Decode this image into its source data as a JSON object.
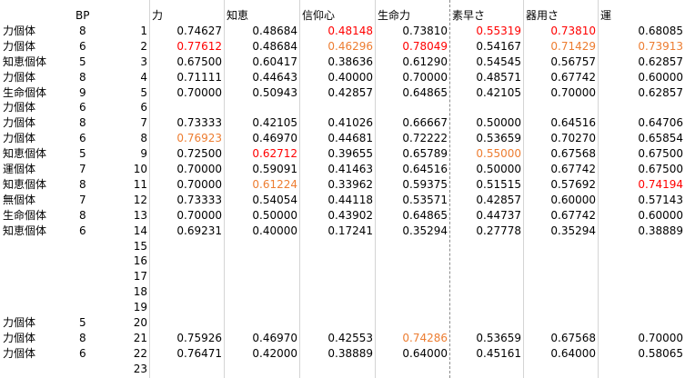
{
  "colors": {
    "red": "#ff0000",
    "orange": "#ed7d31",
    "black": "#000000"
  },
  "header": {
    "bp": "BP",
    "cols": [
      "力",
      "知恵",
      "信仰心",
      "生命力",
      "素早さ",
      "器用さ",
      "運"
    ]
  },
  "rows": [
    {
      "type": "力個体",
      "bp": "8",
      "n": "1",
      "v": [
        "0.74627",
        "0.48684",
        "0.48148",
        "0.73810",
        "0.55319",
        "0.73810",
        "0.68085"
      ],
      "c": [
        "",
        "",
        "red",
        "",
        "red",
        "red",
        ""
      ]
    },
    {
      "type": "力個体",
      "bp": "6",
      "n": "2",
      "v": [
        "0.77612",
        "0.48684",
        "0.46296",
        "0.78049",
        "0.54167",
        "0.71429",
        "0.73913"
      ],
      "c": [
        "red",
        "",
        "orange",
        "red",
        "",
        "orange",
        "orange"
      ]
    },
    {
      "type": "知恵個体",
      "bp": "5",
      "n": "3",
      "v": [
        "0.67500",
        "0.60417",
        "0.38636",
        "0.61290",
        "0.54545",
        "0.56757",
        "0.62857"
      ],
      "c": [
        "",
        "",
        "",
        "",
        "",
        "",
        ""
      ]
    },
    {
      "type": "力個体",
      "bp": "8",
      "n": "4",
      "v": [
        "0.71111",
        "0.44643",
        "0.40000",
        "0.70000",
        "0.48571",
        "0.67742",
        "0.60000"
      ],
      "c": [
        "",
        "",
        "",
        "",
        "",
        "",
        ""
      ]
    },
    {
      "type": "生命個体",
      "bp": "9",
      "n": "5",
      "v": [
        "0.70000",
        "0.50943",
        "0.42857",
        "0.64865",
        "0.42105",
        "0.70000",
        "0.62857"
      ],
      "c": [
        "",
        "",
        "",
        "",
        "",
        "",
        ""
      ]
    },
    {
      "type": "力個体",
      "bp": "6",
      "n": "6",
      "v": [
        "",
        "",
        "",
        "",
        "",
        "",
        ""
      ],
      "c": [
        "",
        "",
        "",
        "",
        "",
        "",
        ""
      ]
    },
    {
      "type": "力個体",
      "bp": "8",
      "n": "7",
      "v": [
        "0.73333",
        "0.42105",
        "0.41026",
        "0.66667",
        "0.50000",
        "0.64516",
        "0.64706"
      ],
      "c": [
        "",
        "",
        "",
        "",
        "",
        "",
        ""
      ]
    },
    {
      "type": "力個体",
      "bp": "6",
      "n": "8",
      "v": [
        "0.76923",
        "0.46970",
        "0.44681",
        "0.72222",
        "0.53659",
        "0.70270",
        "0.65854"
      ],
      "c": [
        "orange",
        "",
        "",
        "",
        "",
        "",
        ""
      ]
    },
    {
      "type": "知恵個体",
      "bp": "5",
      "n": "9",
      "v": [
        "0.72500",
        "0.62712",
        "0.39655",
        "0.65789",
        "0.55000",
        "0.67568",
        "0.67500"
      ],
      "c": [
        "",
        "red",
        "",
        "",
        "orange",
        "",
        ""
      ]
    },
    {
      "type": "運個体",
      "bp": "7",
      "n": "10",
      "v": [
        "0.70000",
        "0.59091",
        "0.41463",
        "0.64516",
        "0.50000",
        "0.67742",
        "0.67500"
      ],
      "c": [
        "",
        "",
        "",
        "",
        "",
        "",
        ""
      ]
    },
    {
      "type": "知恵個体",
      "bp": "8",
      "n": "11",
      "v": [
        "0.70000",
        "0.61224",
        "0.33962",
        "0.59375",
        "0.51515",
        "0.57692",
        "0.74194"
      ],
      "c": [
        "",
        "orange",
        "",
        "",
        "",
        "",
        "red"
      ]
    },
    {
      "type": "無個体",
      "bp": "7",
      "n": "12",
      "v": [
        "0.73333",
        "0.54054",
        "0.44118",
        "0.53571",
        "0.42857",
        "0.60000",
        "0.57143"
      ],
      "c": [
        "",
        "",
        "",
        "",
        "",
        "",
        ""
      ]
    },
    {
      "type": "生命個体",
      "bp": "8",
      "n": "13",
      "v": [
        "0.70000",
        "0.50000",
        "0.43902",
        "0.64865",
        "0.44737",
        "0.67742",
        "0.60000"
      ],
      "c": [
        "",
        "",
        "",
        "",
        "",
        "",
        ""
      ]
    },
    {
      "type": "知恵個体",
      "bp": "6",
      "n": "14",
      "v": [
        "0.69231",
        "0.40000",
        "0.17241",
        "0.35294",
        "0.27778",
        "0.35294",
        "0.38889"
      ],
      "c": [
        "",
        "",
        "",
        "",
        "",
        "",
        ""
      ]
    },
    {
      "type": "",
      "bp": "",
      "n": "15",
      "v": [
        "",
        "",
        "",
        "",
        "",
        "",
        ""
      ],
      "c": [
        "",
        "",
        "",
        "",
        "",
        "",
        ""
      ]
    },
    {
      "type": "",
      "bp": "",
      "n": "16",
      "v": [
        "",
        "",
        "",
        "",
        "",
        "",
        ""
      ],
      "c": [
        "",
        "",
        "",
        "",
        "",
        "",
        ""
      ]
    },
    {
      "type": "",
      "bp": "",
      "n": "17",
      "v": [
        "",
        "",
        "",
        "",
        "",
        "",
        ""
      ],
      "c": [
        "",
        "",
        "",
        "",
        "",
        "",
        ""
      ]
    },
    {
      "type": "",
      "bp": "",
      "n": "18",
      "v": [
        "",
        "",
        "",
        "",
        "",
        "",
        ""
      ],
      "c": [
        "",
        "",
        "",
        "",
        "",
        "",
        ""
      ]
    },
    {
      "type": "",
      "bp": "",
      "n": "19",
      "v": [
        "",
        "",
        "",
        "",
        "",
        "",
        ""
      ],
      "c": [
        "",
        "",
        "",
        "",
        "",
        "",
        ""
      ]
    },
    {
      "type": "力個体",
      "bp": "5",
      "n": "20",
      "v": [
        "",
        "",
        "",
        "",
        "",
        "",
        ""
      ],
      "c": [
        "",
        "",
        "",
        "",
        "",
        "",
        ""
      ]
    },
    {
      "type": "力個体",
      "bp": "8",
      "n": "21",
      "v": [
        "0.75926",
        "0.46970",
        "0.42553",
        "0.74286",
        "0.53659",
        "0.67568",
        "0.70000"
      ],
      "c": [
        "",
        "",
        "",
        "orange",
        "",
        "",
        ""
      ]
    },
    {
      "type": "力個体",
      "bp": "6",
      "n": "22",
      "v": [
        "0.76471",
        "0.42000",
        "0.38889",
        "0.64000",
        "0.45161",
        "0.64000",
        "0.58065"
      ],
      "c": [
        "",
        "",
        "",
        "",
        "",
        "",
        ""
      ]
    },
    {
      "type": "",
      "bp": "",
      "n": "23",
      "v": [
        "",
        "",
        "",
        "",
        "",
        "",
        ""
      ],
      "c": [
        "",
        "",
        "",
        "",
        "",
        "",
        ""
      ]
    }
  ]
}
